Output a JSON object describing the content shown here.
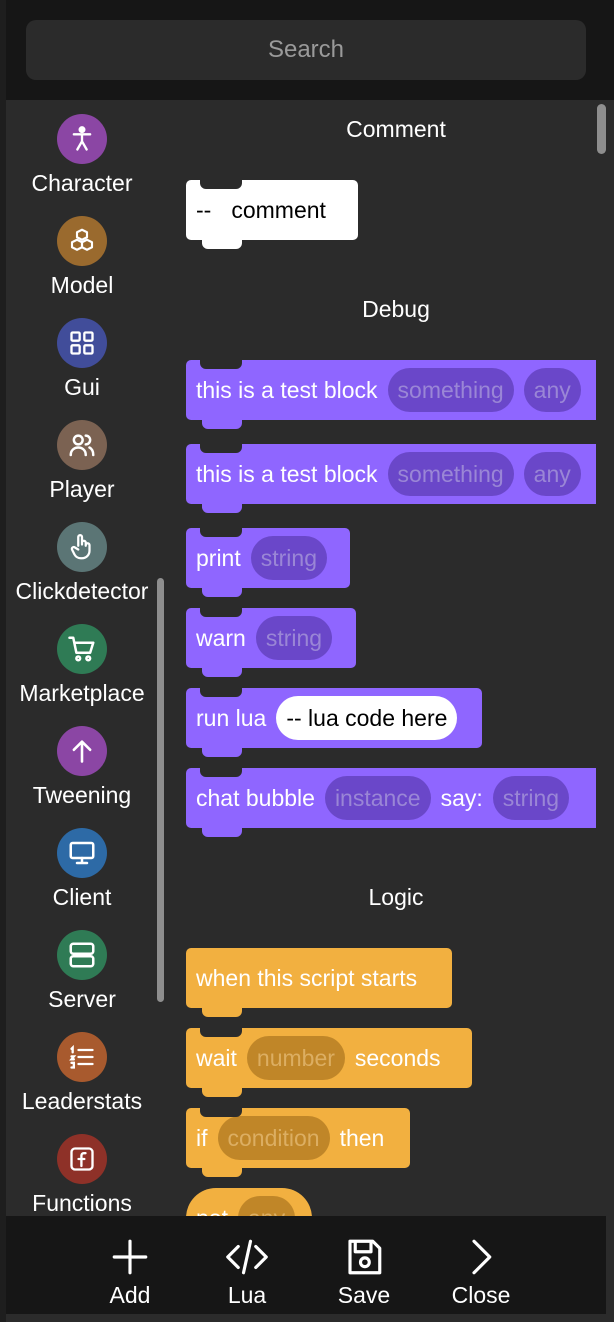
{
  "search": {
    "placeholder": "Search"
  },
  "sidebar": {
    "items": [
      {
        "label": "Character",
        "icon": "person-icon",
        "color": "#8b46a4"
      },
      {
        "label": "Model",
        "icon": "cubes-icon",
        "color": "#9a6a2e"
      },
      {
        "label": "Gui",
        "icon": "grid-icon",
        "color": "#414d9a"
      },
      {
        "label": "Player",
        "icon": "users-icon",
        "color": "#7b6252"
      },
      {
        "label": "Clickdetector",
        "icon": "pointer-icon",
        "color": "#5b7575"
      },
      {
        "label": "Marketplace",
        "icon": "cart-icon",
        "color": "#2f7b55"
      },
      {
        "label": "Tweening",
        "icon": "arrow-up-icon",
        "color": "#8b46a4"
      },
      {
        "label": "Client",
        "icon": "monitor-icon",
        "color": "#2d6aa6"
      },
      {
        "label": "Server",
        "icon": "server-icon",
        "color": "#2f7b55"
      },
      {
        "label": "Leaderstats",
        "icon": "list-icon",
        "color": "#a85a2e"
      },
      {
        "label": "Functions",
        "icon": "function-icon",
        "color": "#8e3128"
      }
    ]
  },
  "sections": {
    "comment": {
      "title": "Comment"
    },
    "debug": {
      "title": "Debug"
    },
    "logic": {
      "title": "Logic"
    }
  },
  "blocks": {
    "comment": {
      "prefix": "--",
      "text": "comment"
    },
    "test1": {
      "text": "this is a test block",
      "slot1": "something",
      "slot2": "any"
    },
    "test2": {
      "text": "this is a test block",
      "slot1": "something",
      "slot2": "any"
    },
    "print": {
      "text": "print",
      "slot": "string"
    },
    "warn": {
      "text": "warn",
      "slot": "string"
    },
    "runlua": {
      "text": "run lua",
      "slot": "-- lua code here"
    },
    "chat": {
      "text": "chat bubble",
      "slot1": "instance",
      "mid": "say:",
      "slot2": "string"
    },
    "start": {
      "text": "when this script starts"
    },
    "wait": {
      "text": "wait",
      "slot": "number",
      "suffix": "seconds"
    },
    "if": {
      "text": "if",
      "slot": "condition",
      "suffix": "then"
    },
    "not": {
      "text": "not",
      "slot": "any"
    }
  },
  "colors": {
    "purple": "#8f66ff",
    "orange": "#f2b040",
    "background": "#2b2b2b"
  },
  "bottombar": {
    "add": "Add",
    "lua": "Lua",
    "save": "Save",
    "close": "Close"
  }
}
